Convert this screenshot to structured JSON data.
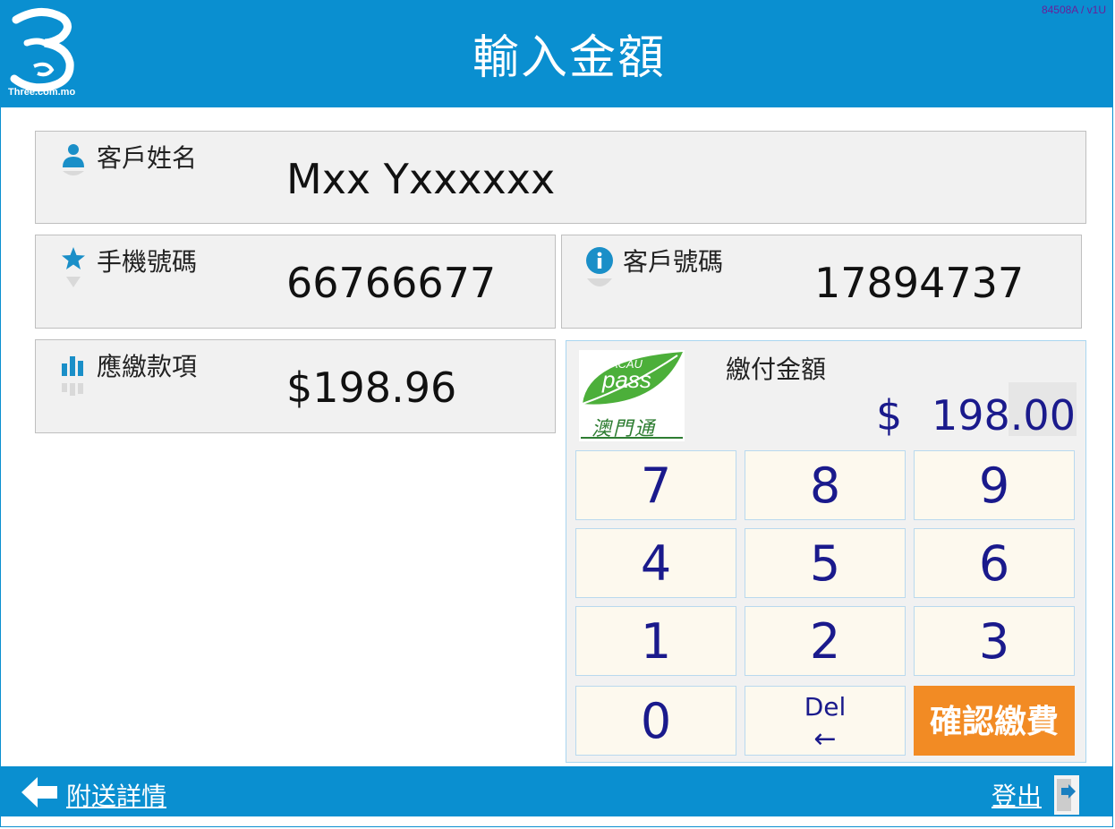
{
  "header": {
    "logo_text": "Three.com.mo",
    "title": "輸入金額",
    "version": "84508A / v1U"
  },
  "customer": {
    "name_label": "客戶姓名",
    "name_value": "Mxx Yxxxxxx",
    "phone_label": "手機號碼",
    "phone_value": "66766677",
    "account_label": "客戶號碼",
    "account_value": "17894737",
    "due_label": "應繳款項",
    "due_value": "$198.96"
  },
  "payment": {
    "label": "繳付金額",
    "currency": "$",
    "amount": "198.00",
    "logo_top": "MACAU",
    "logo_mid": "pass",
    "logo_bottom": "澳門通"
  },
  "keypad": {
    "keys": [
      "7",
      "8",
      "9",
      "4",
      "5",
      "6",
      "1",
      "2",
      "3",
      "0"
    ],
    "del_label": "Del",
    "del_arrow": "←",
    "confirm_label": "確認繳費"
  },
  "footer": {
    "back_label": "附送詳情",
    "logout_label": "登出"
  },
  "colors": {
    "brand_blue": "#0a8fd0",
    "confirm_orange": "#f28b24",
    "key_text": "#1a1a8c"
  }
}
